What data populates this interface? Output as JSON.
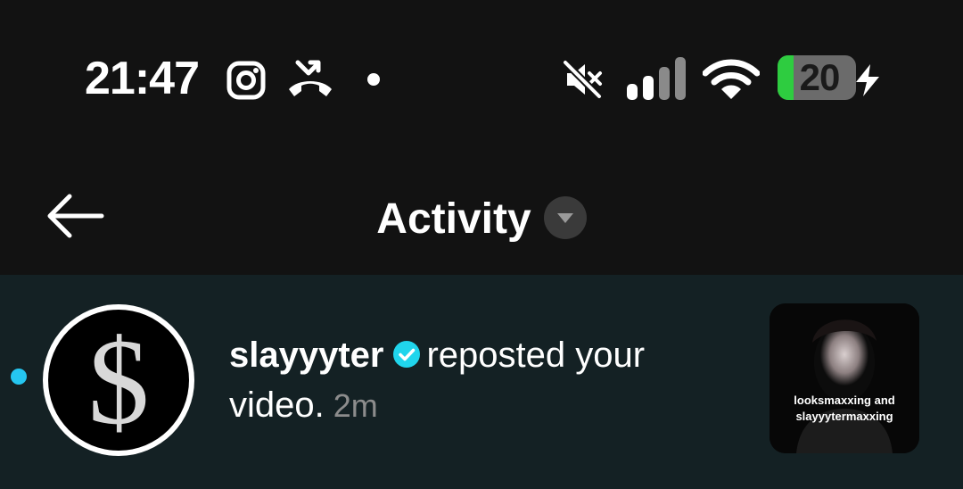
{
  "status_bar": {
    "time": "21:47",
    "battery_level": "20",
    "battery_fraction": 0.2,
    "icons": [
      "instagram-icon",
      "missed-call-icon",
      "notification-dot-icon",
      "muted-icon",
      "signal-icon",
      "wifi-icon",
      "battery-icon",
      "charging-icon"
    ]
  },
  "header": {
    "title": "Activity",
    "back_icon": "back-arrow-icon",
    "dropdown_icon": "chevron-down-icon"
  },
  "activity": [
    {
      "unread": true,
      "avatar_glyph": "$",
      "username": "slayyyter",
      "verified": true,
      "action": "reposted your video.",
      "time": "2m",
      "thumbnail_caption": [
        "looksmaxxing and",
        "slayyytermaxxing"
      ]
    }
  ],
  "colors": {
    "background": "#121212",
    "row_background": "#142124",
    "unread_dot": "#25c6f0",
    "verified_badge": "#20d5ec",
    "battery_fill": "#2ecc40",
    "muted_text": "#8c8c8c"
  }
}
